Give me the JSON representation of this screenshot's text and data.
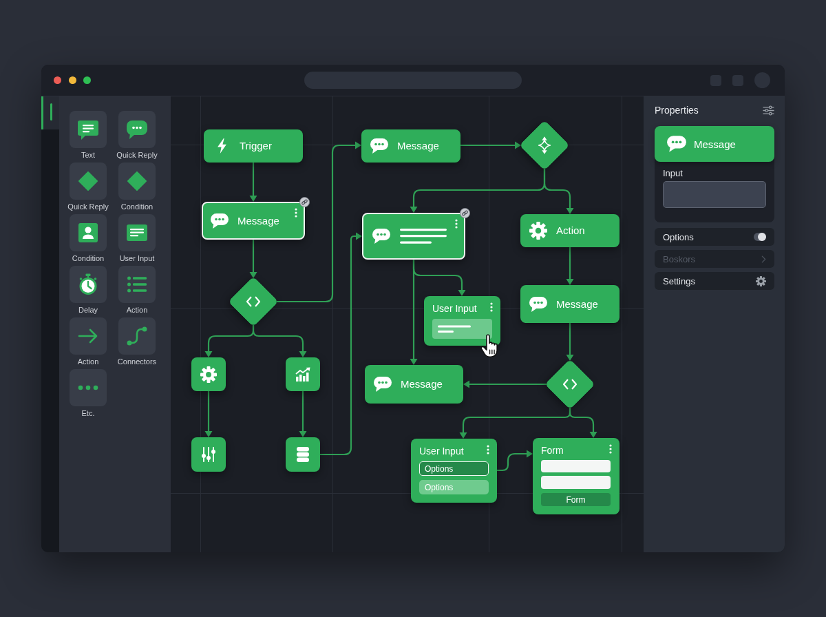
{
  "activity_bar": [
    {
      "selected": true
    }
  ],
  "palette": {
    "items": [
      {
        "kind": "text",
        "label": "Text"
      },
      {
        "kind": "reply",
        "label": "Quick Reply"
      },
      {
        "kind": "branch",
        "label": "Quick Reply"
      },
      {
        "kind": "branch",
        "label": "Condition"
      },
      {
        "kind": "contact",
        "label": "Condition"
      },
      {
        "kind": "input",
        "label": "User Input"
      },
      {
        "kind": "timer",
        "label": "Delay"
      },
      {
        "kind": "list",
        "label": "Action"
      },
      {
        "kind": "arrow",
        "label": "Action"
      },
      {
        "kind": "connector",
        "label": "Connectors"
      },
      {
        "kind": "more",
        "label": "Etc."
      }
    ]
  },
  "canvas": {
    "nodes": [
      {
        "kind": "trigger",
        "label": "Trigger",
        "selected": false
      },
      {
        "kind": "message",
        "label": "Message",
        "selected": false
      },
      {
        "kind": "router",
        "selected": false
      },
      {
        "kind": "message",
        "label": "Message",
        "selected": true
      },
      {
        "kind": "preview",
        "selected": true
      },
      {
        "kind": "action",
        "label": "Action",
        "selected": false
      },
      {
        "kind": "branch",
        "selected": false
      },
      {
        "kind": "entry",
        "label": "User Input",
        "selected": false
      },
      {
        "kind": "message",
        "label": "Message",
        "selected": false
      },
      {
        "kind": "setup",
        "selected": false
      },
      {
        "kind": "metrics",
        "selected": false
      },
      {
        "kind": "message",
        "label": "Message",
        "selected": false
      },
      {
        "kind": "branch",
        "selected": false
      },
      {
        "kind": "tuning",
        "selected": false
      },
      {
        "kind": "storage",
        "selected": false
      },
      {
        "kind": "choice",
        "label": "User Input",
        "selected": false,
        "options": [
          {
            "label": "Options",
            "selected": true
          },
          {
            "label": "Options",
            "selected": false
          }
        ]
      },
      {
        "kind": "form",
        "label": "Form",
        "selected": false,
        "button": "Form"
      }
    ]
  },
  "properties": {
    "title": "Properties",
    "selected_node": {
      "label": "Message"
    },
    "input": {
      "label": "Input"
    },
    "rows": [
      {
        "kind": "toggle",
        "label": "Options",
        "on": true,
        "disabled": false
      },
      {
        "kind": "link",
        "label": "Boskors",
        "disabled": true
      },
      {
        "kind": "gear",
        "label": "Settings",
        "disabled": false
      }
    ]
  }
}
